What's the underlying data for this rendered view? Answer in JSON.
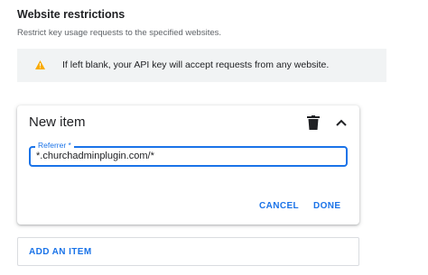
{
  "section": {
    "title": "Website restrictions",
    "subtitle": "Restrict key usage requests to the specified websites."
  },
  "warning": {
    "icon": "warning-icon",
    "icon_color": "#f9ab00",
    "text": "If left blank, your API key will accept requests from any website."
  },
  "item": {
    "title": "New item",
    "delete_icon": "delete-icon",
    "collapse_icon": "chevron-up-icon",
    "referrer": {
      "label": "Referrer *",
      "value": "*.churchadminplugin.com/*"
    },
    "cancel_label": "CANCEL",
    "done_label": "DONE"
  },
  "add_item": {
    "label": "ADD AN ITEM"
  },
  "colors": {
    "accent": "#1a73e8",
    "banner_bg": "#f1f3f4",
    "text": "#202124",
    "muted": "#5f6368"
  }
}
